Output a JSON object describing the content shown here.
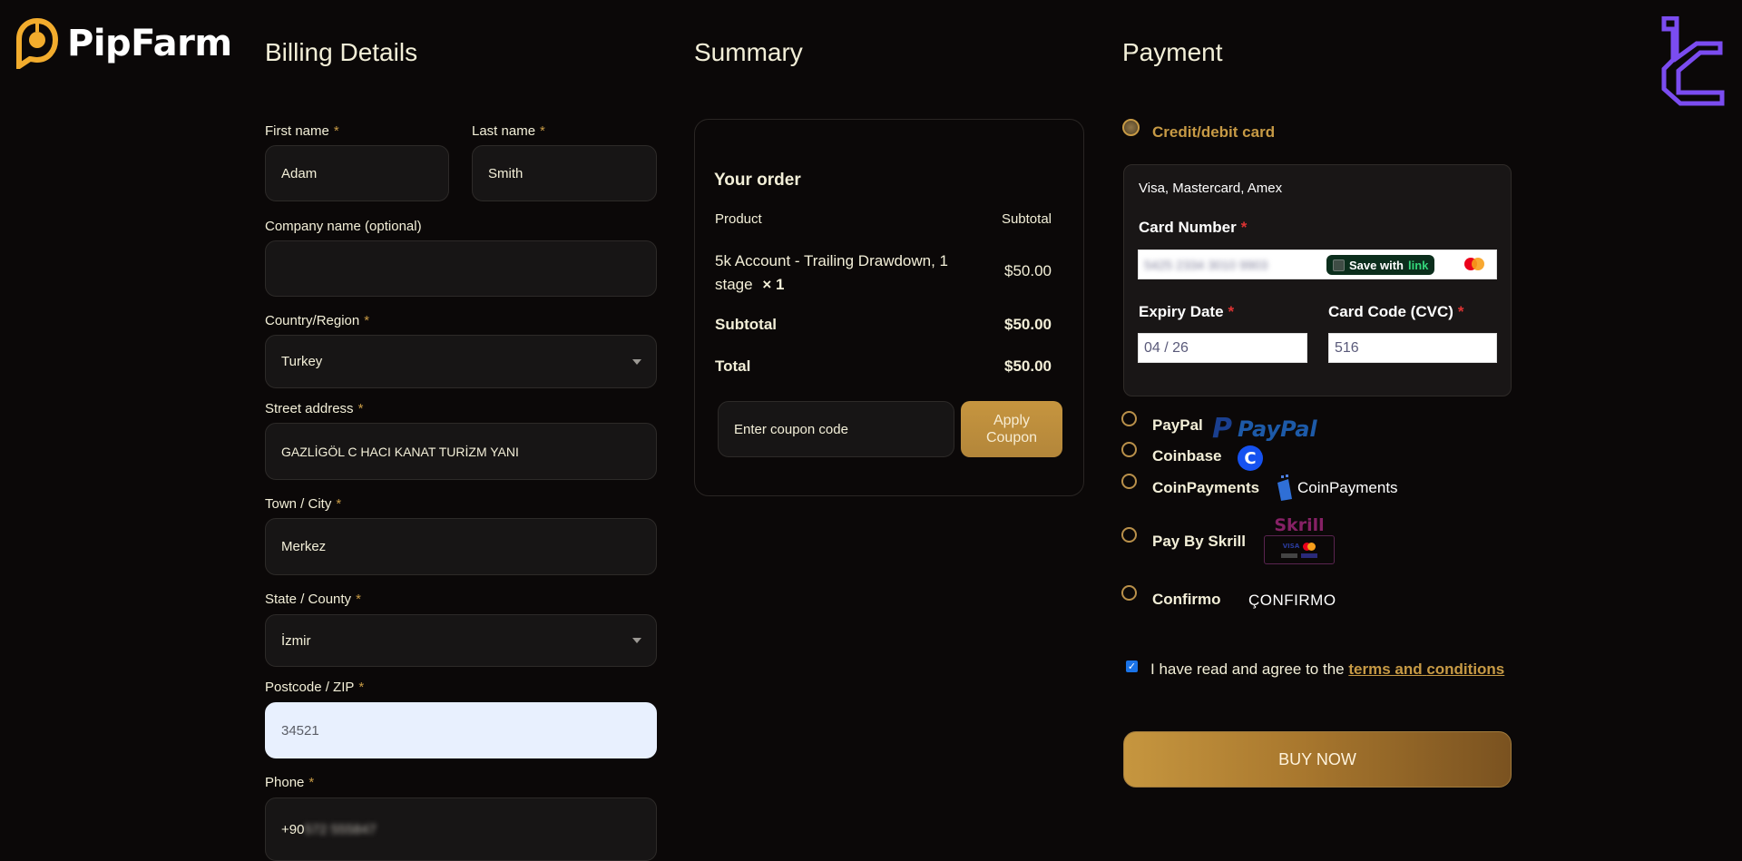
{
  "brand": {
    "name": "PipFarm",
    "accent": "#f2ac2d"
  },
  "watermark": {
    "icon": "tradingfinder-logo",
    "color": "#7b4cf0"
  },
  "billing": {
    "title": "Billing Details",
    "required_mark": "*",
    "fields": {
      "first_name": {
        "label": "First name",
        "value": "Adam"
      },
      "last_name": {
        "label": "Last name",
        "value": "Smith"
      },
      "company": {
        "label": "Company name (optional)",
        "value": ""
      },
      "country": {
        "label": "Country/Region",
        "value": "Turkey"
      },
      "street": {
        "label": "Street address",
        "value": "GAZLİGÖL C HACI KANAT TURİZM YANI"
      },
      "city": {
        "label": "Town / City",
        "value": "Merkez"
      },
      "state": {
        "label": "State / County",
        "value": "İzmir"
      },
      "postcode": {
        "label": "Postcode / ZIP",
        "value": "34521"
      },
      "phone": {
        "label": "Phone",
        "value_prefix": "+90",
        "value_blurred": "572 555847"
      }
    }
  },
  "summary": {
    "title": "Summary",
    "order_title": "Your order",
    "col_product": "Product",
    "col_subtotal": "Subtotal",
    "item": {
      "name": "5k Account - Trailing Drawdown, 1 stage",
      "qty": "× 1",
      "price": "$50.00"
    },
    "subtotal_label": "Subtotal",
    "subtotal_value": "$50.00",
    "total_label": "Total",
    "total_value": "$50.00",
    "coupon_placeholder": "Enter coupon code",
    "apply_label_line1": "Apply",
    "apply_label_line2": "Coupon"
  },
  "payment": {
    "title": "Payment",
    "selected": "Credit/debit card",
    "credit_card": {
      "label": "Credit/debit card",
      "accepted": "Visa, Mastercard, Amex",
      "card_number_label": "Card Number",
      "card_number_blurred": "5425 2334 3010 9903",
      "save_with": "Save with",
      "link_word": "link",
      "expiry_label": "Expiry Date",
      "expiry_value": "04 / 26",
      "cvc_label": "Card Code (CVC)",
      "cvc_value": "516"
    },
    "methods": [
      {
        "label": "PayPal",
        "logo_text": "PayPal"
      },
      {
        "label": "Coinbase",
        "logo_text": "C"
      },
      {
        "label": "CoinPayments",
        "logo_text": "CoinPayments"
      },
      {
        "label": "Pay By Skrill",
        "logo_text": "Skrill"
      },
      {
        "label": "Confirmo",
        "logo_text": "ÇONFIRMO"
      }
    ],
    "terms_checked": true,
    "terms_text": "I have read and agree to the",
    "terms_link_line1": "terms and",
    "terms_link_line2": "conditions",
    "buy_label": "BUY NOW"
  }
}
